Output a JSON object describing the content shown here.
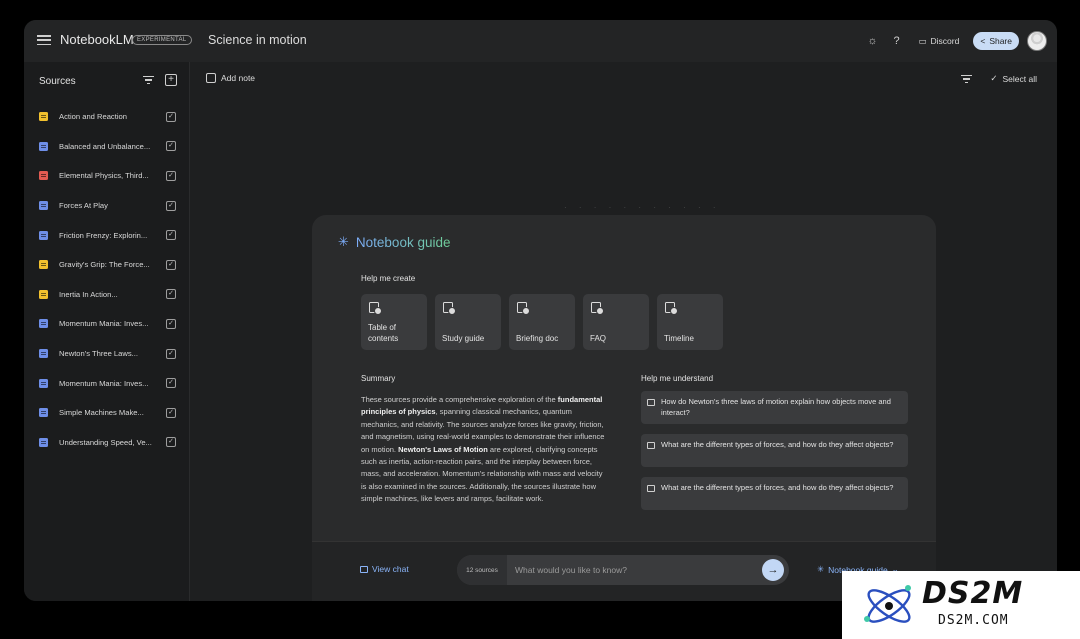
{
  "app": {
    "name": "NotebookLM",
    "badge": "EXPERIMENTAL",
    "notebook_title": "Science in motion"
  },
  "topbar": {
    "discord_label": "Discord",
    "share_label": "Share",
    "icons": [
      "theme-icon",
      "help-icon",
      "discord-icon",
      "share-icon",
      "avatar"
    ]
  },
  "sidebar": {
    "heading": "Sources",
    "items": [
      {
        "label": "Action and Reaction",
        "icon_color": "#f2c12e"
      },
      {
        "label": "Balanced and Unbalance...",
        "icon_color": "#6f8fe8"
      },
      {
        "label": "Elemental Physics, Third...",
        "icon_color": "#e25b52"
      },
      {
        "label": "Forces At Play",
        "icon_color": "#6f8fe8"
      },
      {
        "label": "Friction Frenzy: Explorin...",
        "icon_color": "#6f8fe8"
      },
      {
        "label": "Gravity's Grip: The Force...",
        "icon_color": "#f2c12e"
      },
      {
        "label": "Inertia In Action...",
        "icon_color": "#f2c12e"
      },
      {
        "label": "Momentum Mania: Inves...",
        "icon_color": "#6f8fe8"
      },
      {
        "label": "Newton's Three Laws...",
        "icon_color": "#6f8fe8"
      },
      {
        "label": "Momentum Mania: Inves...",
        "icon_color": "#6f8fe8"
      },
      {
        "label": "Simple Machines Make...",
        "icon_color": "#6f8fe8"
      },
      {
        "label": "Understanding Speed, Ve...",
        "icon_color": "#6f8fe8"
      }
    ]
  },
  "main": {
    "add_note_label": "Add note",
    "select_all_label": "Select all"
  },
  "guide": {
    "title": "Notebook guide",
    "help_create_heading": "Help me create",
    "cards": [
      {
        "label": "Table of contents"
      },
      {
        "label": "Study guide"
      },
      {
        "label": "Briefing doc"
      },
      {
        "label": "FAQ"
      },
      {
        "label": "Timeline"
      }
    ],
    "summary_heading": "Summary",
    "summary_parts": [
      {
        "text": "These sources provide a comprehensive exploration of the ",
        "bold": false
      },
      {
        "text": "fundamental principles of physics",
        "bold": true
      },
      {
        "text": ", spanning classical mechanics, quantum mechanics, and relativity. The sources analyze forces like gravity, friction, and magnetism, using real-world examples to demonstrate their influence on motion. ",
        "bold": false
      },
      {
        "text": "Newton's Laws of Motion",
        "bold": true
      },
      {
        "text": " are explored, clarifying concepts such as inertia, action-reaction pairs, and the interplay between force, mass, and acceleration. Momentum's relationship with mass and velocity is also examined in the sources. Additionally, the sources illustrate how simple machines, like levers and ramps, facilitate work.",
        "bold": false
      }
    ],
    "understand_heading": "Help me understand",
    "questions": [
      "How do Newton's three laws of motion explain how objects move and interact?",
      "What are the different types of forces, and how do they affect objects?",
      "What are the different types of forces, and how do they affect objects?"
    ],
    "footer": {
      "view_chat_label": "View chat",
      "sources_count": "12 sources",
      "input_placeholder": "What would you like to know?",
      "guide_link_label": "Notebook guide"
    }
  },
  "watermark": {
    "logo_text": "DS2M",
    "sub_text": "DS2M.COM"
  }
}
